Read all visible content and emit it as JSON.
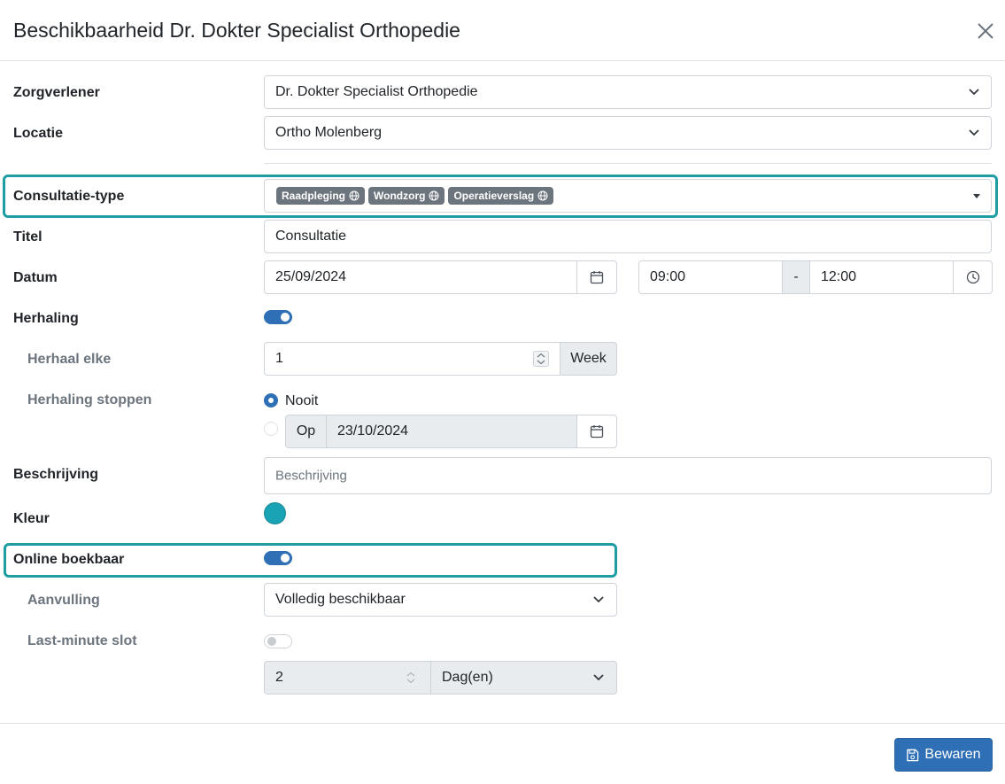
{
  "modal": {
    "title": "Beschikbaarheid Dr. Dokter Specialist Orthopedie"
  },
  "colors": {
    "primary": "#2f6fb5",
    "highlight": "#1e9ea4",
    "tag": "#6c757d",
    "event_color": "#1aa3b5"
  },
  "form": {
    "zorgverlener": {
      "label": "Zorgverlener",
      "value": "Dr. Dokter Specialist Orthopedie"
    },
    "locatie": {
      "label": "Locatie",
      "value": "Ortho Molenberg"
    },
    "consultatie_type": {
      "label": "Consultatie-type",
      "tags": [
        "Raadpleging",
        "Wondzorg",
        "Operatieverslag"
      ]
    },
    "titel": {
      "label": "Titel",
      "value": "Consultatie"
    },
    "datum": {
      "label": "Datum",
      "date": "25/09/2024",
      "start_time": "09:00",
      "separator": "-",
      "end_time": "12:00"
    },
    "herhaling": {
      "label": "Herhaling",
      "enabled": true
    },
    "herhaal_elke": {
      "label": "Herhaal elke",
      "value": "1",
      "unit": "Week"
    },
    "herhaling_stoppen": {
      "label": "Herhaling stoppen",
      "option_never": "Nooit",
      "option_on_prefix": "Op",
      "option_on_date": "23/10/2024",
      "selected": "Nooit"
    },
    "beschrijving": {
      "label": "Beschrijving",
      "placeholder": "Beschrijving"
    },
    "kleur": {
      "label": "Kleur"
    },
    "online_boekbaar": {
      "label": "Online boekbaar",
      "enabled": true
    },
    "aanvulling": {
      "label": "Aanvulling",
      "value": "Volledig beschikbaar"
    },
    "last_minute_slot": {
      "label": "Last-minute slot",
      "enabled": false,
      "amount": "2",
      "unit": "Dag(en)"
    }
  },
  "footer": {
    "save_label": "Bewaren"
  }
}
